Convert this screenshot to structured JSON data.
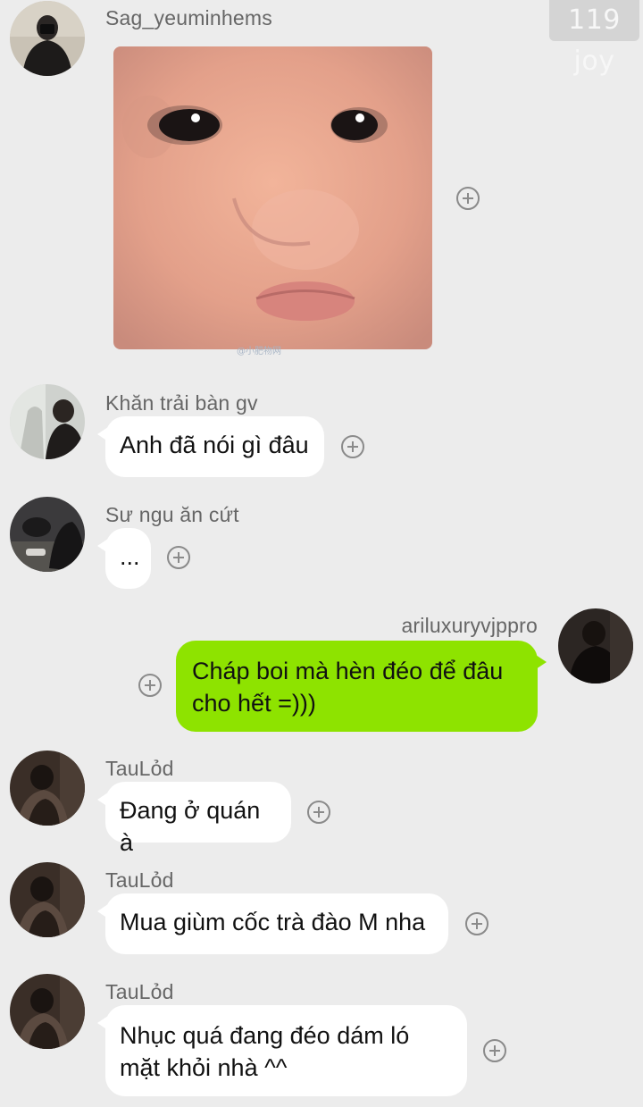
{
  "header": {
    "joy_badge": "119 joy"
  },
  "messages": [
    {
      "sender": "Sag_yeuminhems",
      "type": "image",
      "image_desc": "crying baby face sticker",
      "watermark": "@小肥物网"
    },
    {
      "sender": "Khăn trải bàn gv",
      "text": "Anh đã nói gì đâu"
    },
    {
      "sender": "Sư ngu ăn cứt",
      "text": "..."
    },
    {
      "sender": "ariluxuryvjppro",
      "text_line1": "Cháp boi mà hèn đéo để đâu",
      "text_line2": "cho hết =)))",
      "mine": true
    },
    {
      "sender": "TauLỏd",
      "text": "Đang ở quán à"
    },
    {
      "sender": "TauLỏd",
      "text": "Mua giùm cốc trà đào M nha"
    },
    {
      "sender": "TauLỏd",
      "text_line1": "Nhục quá đang đéo dám ló",
      "text_line2": "mặt khỏi nhà ^^"
    }
  ],
  "colors": {
    "background": "#ececec",
    "my_bubble": "#8ee300",
    "other_bubble": "#ffffff",
    "name_text": "#666666"
  },
  "icons": {
    "reaction": "add-circle-icon"
  }
}
